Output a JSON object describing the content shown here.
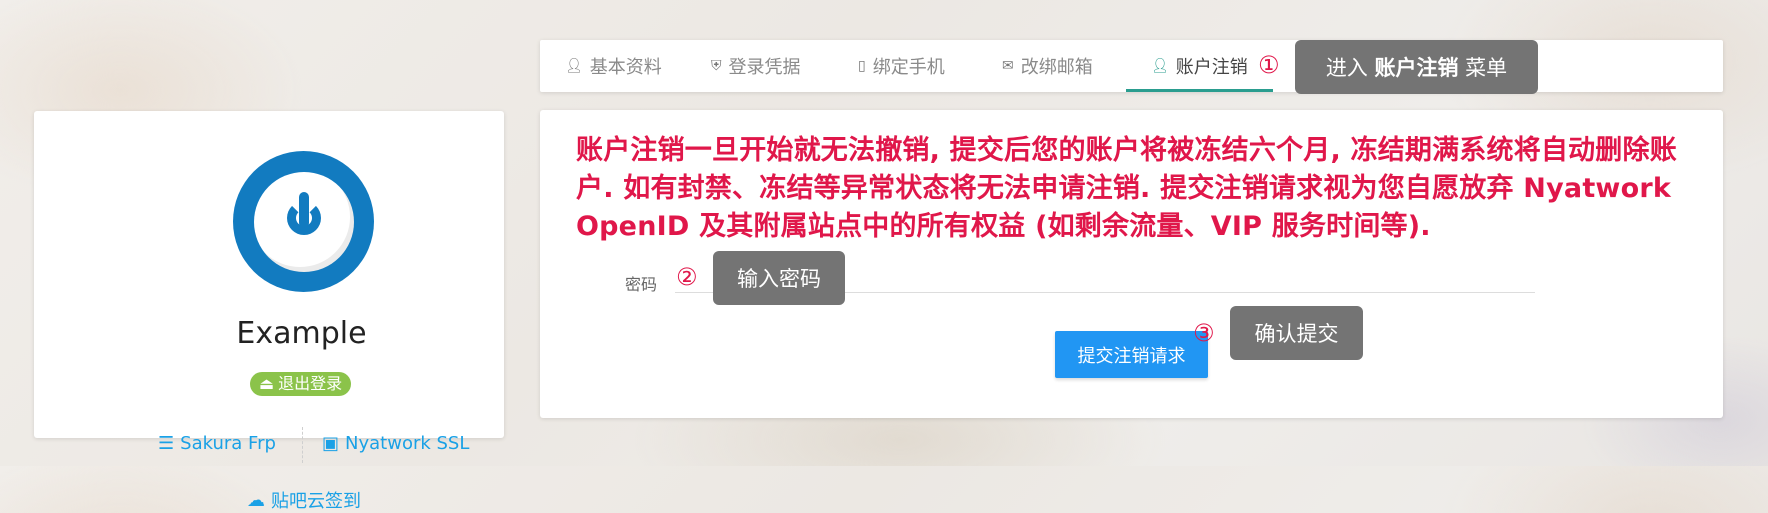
{
  "profile": {
    "username": "Example",
    "logout_label": "退出登录",
    "links": [
      {
        "label": "Sakura Frp",
        "icon": "server-icon"
      },
      {
        "label": "Nyatwork SSL",
        "icon": "certificate-icon"
      },
      {
        "label": "贴吧云签到",
        "icon": "cloud-icon"
      }
    ]
  },
  "tabs": [
    {
      "label": "基本资料",
      "icon": "user-icon"
    },
    {
      "label": "登录凭据",
      "icon": "shield-icon"
    },
    {
      "label": "绑定手机",
      "icon": "phone-icon"
    },
    {
      "label": "改绑邮箱",
      "icon": "mail-icon"
    },
    {
      "label": "账户注销",
      "icon": "user-remove-icon",
      "active": true
    }
  ],
  "cancel_form": {
    "warning": "账户注销一旦开始就无法撤销, 提交后您的账户将被冻结六个月, 冻结期满系统将自动删除账户. 如有封禁、冻结等异常状态将无法申请注销. 提交注销请求视为您自愿放弃 Nyatwork OpenID 及其附属站点中的所有权益 (如剩余流量、VIP 服务时间等).",
    "password_label": "密码",
    "password_value": "",
    "submit_label": "提交注销请求"
  },
  "annotations": {
    "step1_marker": "①",
    "step1_text_a": "进入 ",
    "step1_text_b": "账户注销",
    "step1_text_c": " 菜单",
    "step2_marker": "②",
    "step2_text": "输入密码",
    "step3_marker": "③",
    "step3_text": "确认提交"
  },
  "colors": {
    "accent_teal": "#2a9d8f",
    "warning_red": "#e0174a",
    "link_blue": "#1aa1e6",
    "submit_blue": "#2196f3",
    "logout_green": "#8bc34a",
    "avatar_blue": "#127bc0",
    "callout_gray": "#747474"
  }
}
